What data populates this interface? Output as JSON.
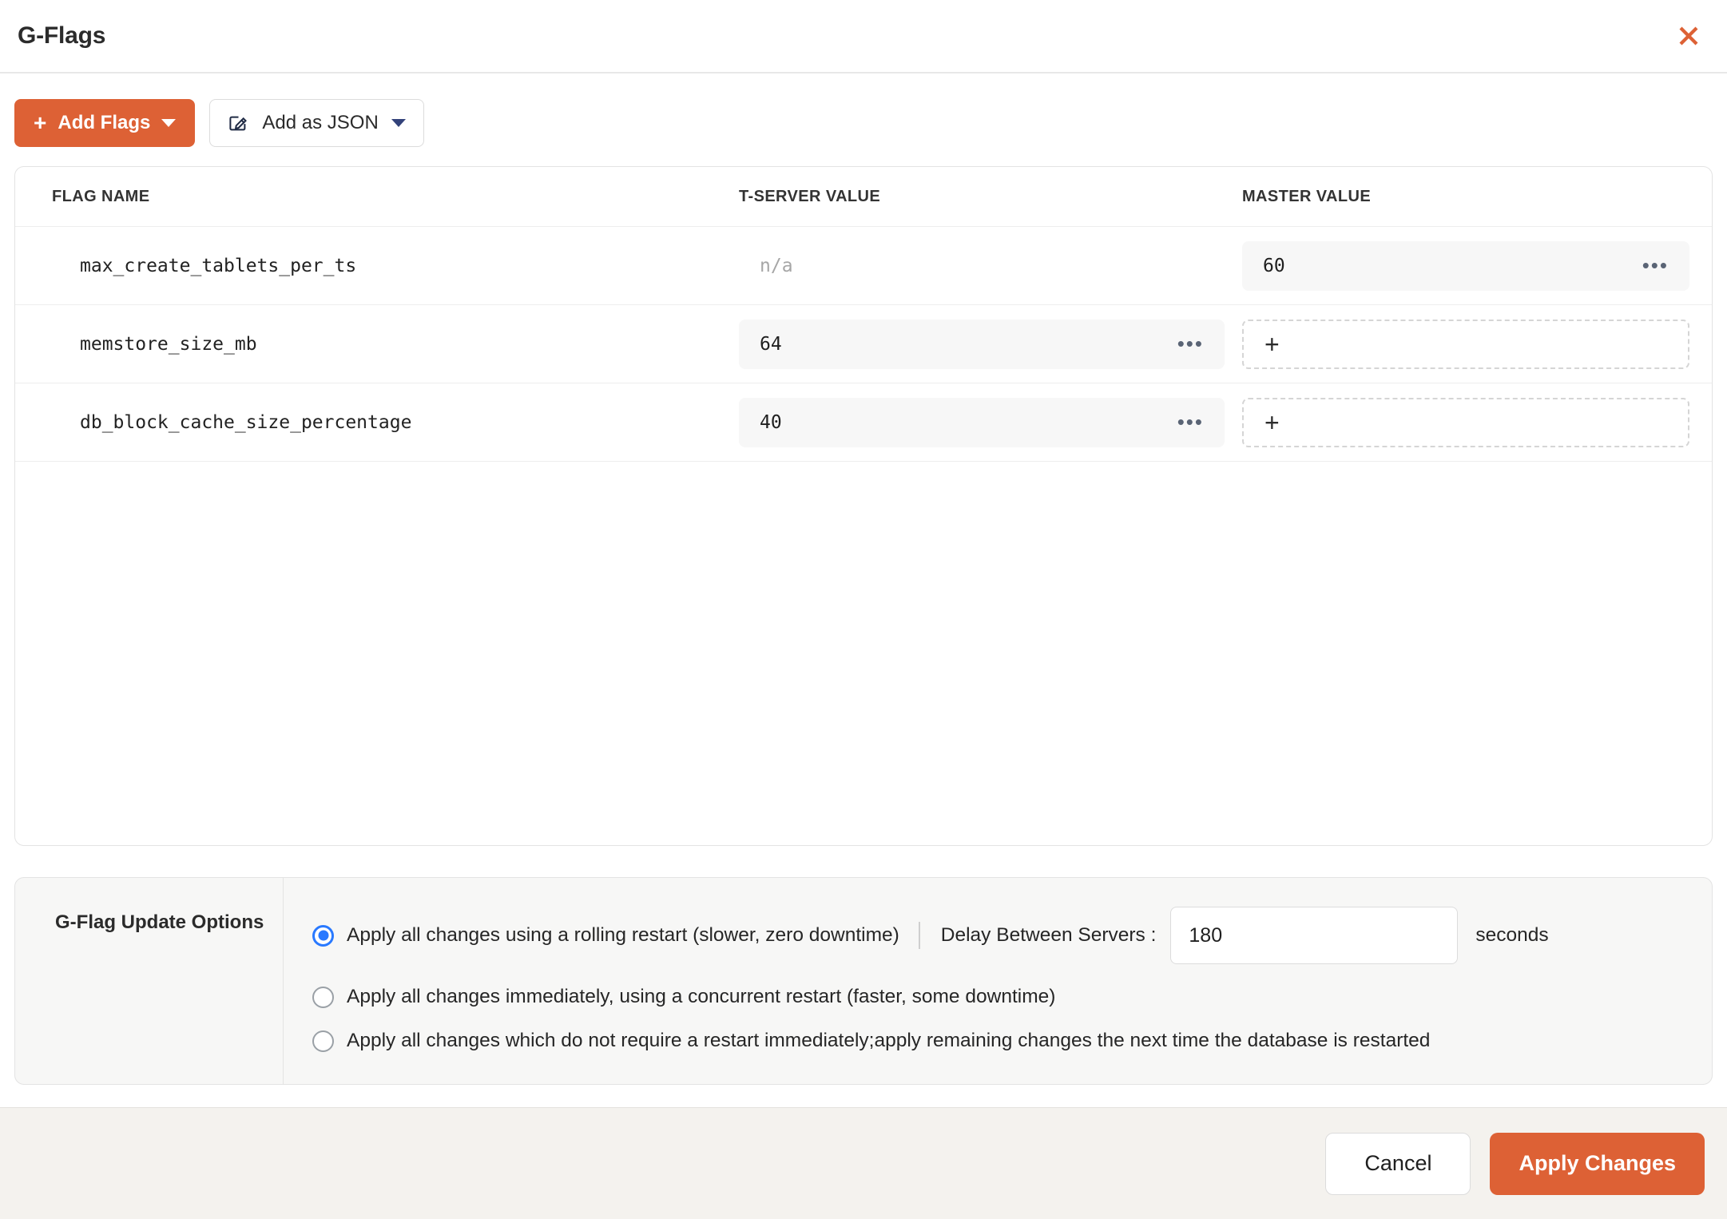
{
  "modal": {
    "title": "G-Flags",
    "close_icon": "close-x-icon"
  },
  "toolbar": {
    "add_flags_label": "Add Flags",
    "add_flags_plus": "+",
    "add_as_json_label": "Add as JSON",
    "edit_icon": "edit-pencil-icon"
  },
  "table": {
    "columns": [
      "FLAG NAME",
      "T-SERVER VALUE",
      "MASTER VALUE"
    ],
    "rows": [
      {
        "flag_name": "max_create_tablets_per_ts",
        "tserver_value": "n/a",
        "tserver_has_value": false,
        "master_value": "60",
        "master_has_value": true,
        "menu_icon": "ellipsis-icon"
      },
      {
        "flag_name": "memstore_size_mb",
        "tserver_value": "64",
        "tserver_has_value": true,
        "master_value": "+",
        "master_has_value": false,
        "menu_icon": "ellipsis-icon"
      },
      {
        "flag_name": "db_block_cache_size_percentage",
        "tserver_value": "40",
        "tserver_has_value": true,
        "master_value": "+",
        "master_has_value": false,
        "menu_icon": "ellipsis-icon"
      }
    ],
    "ellipsis_glyph": "•••",
    "plus_glyph": "+"
  },
  "options": {
    "section_label": "G-Flag Update Options",
    "radios": [
      {
        "label": "Apply all changes using a rolling restart (slower, zero downtime)",
        "checked": true
      },
      {
        "label": "Apply all changes immediately, using a concurrent restart (faster, some downtime)",
        "checked": false
      },
      {
        "label": "Apply all changes which do not require a restart immediately;apply remaining changes the next time the database is restarted",
        "checked": false
      }
    ],
    "delay_label": "Delay Between Servers :",
    "delay_value": "180",
    "delay_placeholder": "180",
    "delay_units": "seconds"
  },
  "footer": {
    "cancel_label": "Cancel",
    "apply_label": "Apply Changes"
  },
  "colors": {
    "accent": "#dd6135",
    "radio_blue": "#2979ff",
    "footer_bg": "#f4f2ee"
  }
}
